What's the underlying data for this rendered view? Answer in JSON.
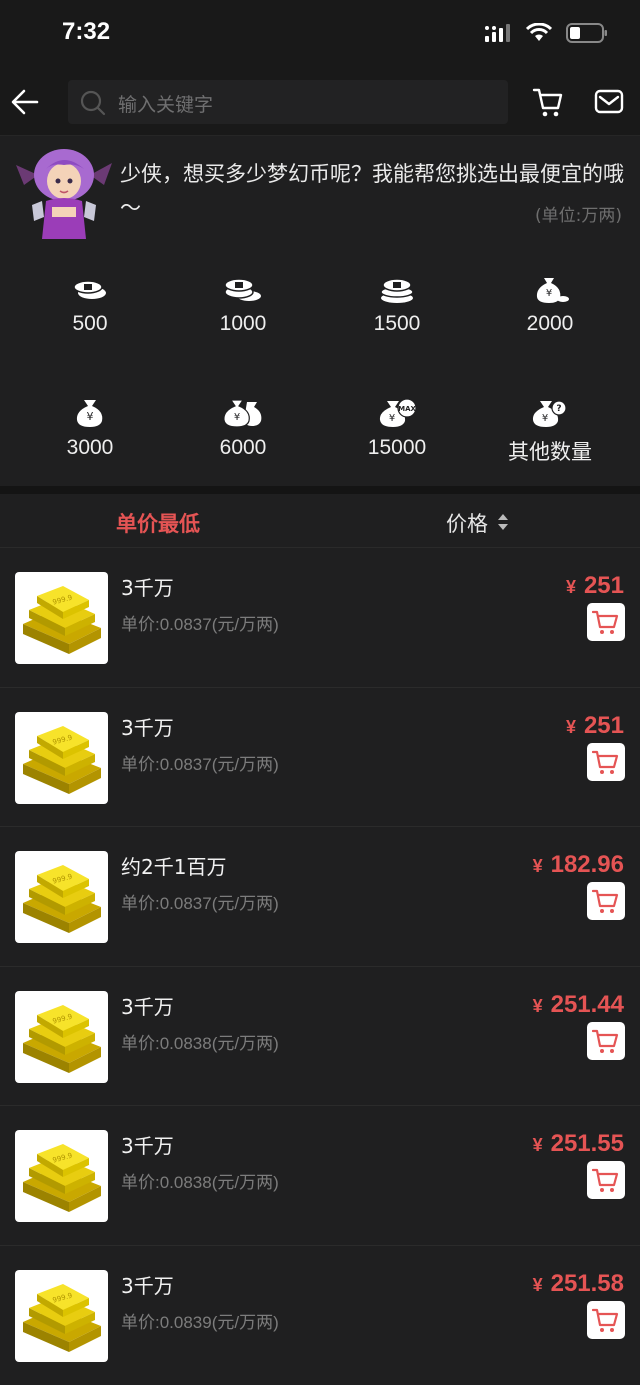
{
  "status_bar": {
    "time": "7:32"
  },
  "search": {
    "placeholder": "输入关键字"
  },
  "promo": {
    "message": "少侠，想买多少梦幻币呢？我能帮您挑选出最便宜的哦～",
    "unit_note": "(单位:万两)"
  },
  "quantities": [
    "500",
    "1000",
    "1500",
    "2000",
    "3000",
    "6000",
    "15000",
    "其他数量"
  ],
  "sort": {
    "lowest_unit_price": "单价最低",
    "price": "价格"
  },
  "items": [
    {
      "title": "3千万",
      "unit_price": "单价:0.0837(元/万两)",
      "currency": "¥",
      "price": "251"
    },
    {
      "title": "3千万",
      "unit_price": "单价:0.0837(元/万两)",
      "currency": "¥",
      "price": "251"
    },
    {
      "title": "约2千1百万",
      "unit_price": "单价:0.0837(元/万两)",
      "currency": "¥",
      "price": "182.96"
    },
    {
      "title": "3千万",
      "unit_price": "单价:0.0838(元/万两)",
      "currency": "¥",
      "price": "251.44"
    },
    {
      "title": "3千万",
      "unit_price": "单价:0.0838(元/万两)",
      "currency": "¥",
      "price": "251.55"
    },
    {
      "title": "3千万",
      "unit_price": "单价:0.0839(元/万两)",
      "currency": "¥",
      "price": "251.58"
    }
  ],
  "colors": {
    "accent": "#e55454",
    "background": "#1f1f20"
  }
}
